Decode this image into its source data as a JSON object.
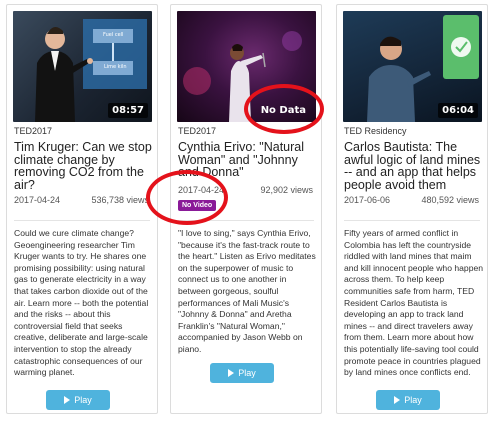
{
  "cards": [
    {
      "duration": "08:57",
      "event": "TED2017",
      "title": "Tim Kruger: Can we stop climate change by removing CO2 from the air?",
      "date": "2017-04-24",
      "views": "536,738 views",
      "description": "Could we cure climate change? Geoengineering researcher Tim Kruger wants to try. He shares one promising possibility: using natural gas to generate electricity in a way that takes carbon dioxide out of the air. Learn more -- both the potential and the risks -- about this controversial field that seeks creative, deliberate and large-scale intervention to stop the already catastrophic consequences of our warming planet.",
      "play_label": "Play",
      "screen_labels": [
        "Fuel cell",
        "Lime kiln"
      ]
    },
    {
      "no_data_label": "No Data",
      "event": "TED2017",
      "title": "Cynthia Erivo: \"Natural Woman\" and \"Johnny and Donna\"",
      "date": "2017-04-24",
      "views": "92,902 views",
      "no_video_label": "No Video",
      "description": "\"I love to sing,\" says Cynthia Erivo, \"because it's the fast-track route to the heart.\" Listen as Erivo meditates on the superpower of music to connect us to one another in between gorgeous, soulful performances of Mali Music's \"Johnny & Donna\" and Aretha Franklin's \"Natural Woman,\" accompanied by Jason Webb on piano.",
      "play_label": "Play"
    },
    {
      "duration": "06:04",
      "event": "TED Residency",
      "title": "Carlos Bautista: The awful logic of land mines -- and an app that helps people avoid them",
      "date": "2017-06-06",
      "views": "480,592 views",
      "description": "Fifty years of armed conflict in Colombia has left the countryside riddled with land mines that maim and kill innocent people who happen across them. To help keep communities safe from harm, TED Resident Carlos Bautista is developing an app to track land mines -- and direct travelers away from them. Learn more about how this potentially life-saving tool could promote peace in countries plagued by land mines once conflicts end.",
      "play_label": "Play"
    }
  ],
  "colors": {
    "play_button": "#4fb3dd",
    "no_video_badge": "#8a1a98",
    "highlight_ring": "#e4121b"
  }
}
